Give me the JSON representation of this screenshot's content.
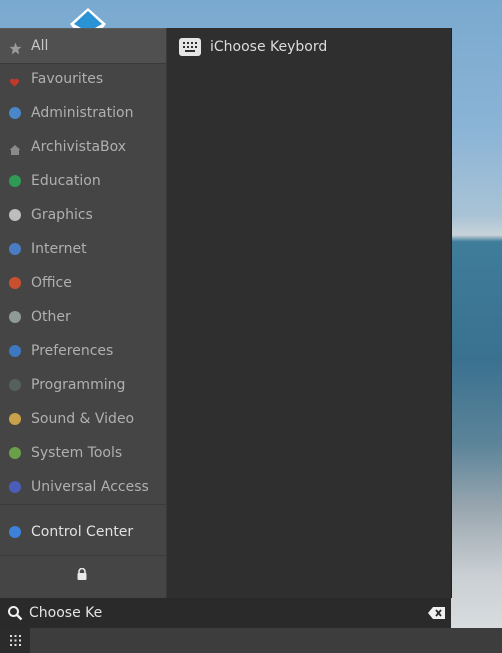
{
  "menu": {
    "categories": [
      {
        "label": "All",
        "icon": "star-icon",
        "color": "#9a9a9a",
        "active": true
      },
      {
        "label": "Favourites",
        "icon": "heart-icon",
        "color": "#c0392b"
      },
      {
        "label": "Administration",
        "icon": "administration-icon",
        "color": "#4a86c8"
      },
      {
        "label": "ArchivistaBox",
        "icon": "home-icon",
        "color": "#8a8a8a"
      },
      {
        "label": "Education",
        "icon": "education-icon",
        "color": "#2e9a55"
      },
      {
        "label": "Graphics",
        "icon": "graphics-icon",
        "color": "#bdbdbd"
      },
      {
        "label": "Internet",
        "icon": "internet-icon",
        "color": "#4a7cc4"
      },
      {
        "label": "Office",
        "icon": "office-icon",
        "color": "#c9502f"
      },
      {
        "label": "Other",
        "icon": "other-icon",
        "color": "#8f9a96"
      },
      {
        "label": "Preferences",
        "icon": "preferences-icon",
        "color": "#3d78c0"
      },
      {
        "label": "Programming",
        "icon": "programming-icon",
        "color": "#56605c"
      },
      {
        "label": "Sound & Video",
        "icon": "sound-video-icon",
        "color": "#c9a14a"
      },
      {
        "label": "System Tools",
        "icon": "system-tools-icon",
        "color": "#6aa04a"
      },
      {
        "label": "Universal Access",
        "icon": "universal-access-icon",
        "color": "#4b5db8"
      }
    ],
    "control_center": {
      "label": "Control Center",
      "color": "#3b82d8"
    },
    "results": [
      {
        "label": "iChoose Keybord",
        "icon": "keyboard-icon"
      }
    ]
  },
  "search": {
    "value": "Choose Ke"
  }
}
